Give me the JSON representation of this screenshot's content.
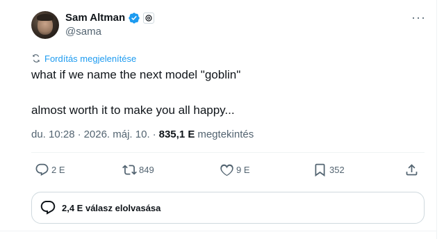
{
  "author": {
    "name": "Sam Altman",
    "handle": "@sama"
  },
  "translate_link": "Fordítás megjelenítése",
  "tweet": {
    "line1": "what if we name the next model \"goblin\"",
    "line2": "almost worth it to make you all happy..."
  },
  "meta": {
    "time": "du. 10:28",
    "separator1": "·",
    "date": "2026. máj. 10.",
    "separator2": "·",
    "views_count": "835,1 E",
    "views_label": "megtekintés"
  },
  "actions": {
    "replies": "2 E",
    "reposts": "849",
    "likes": "9 E",
    "bookmarks": "352"
  },
  "read_replies": "2,4 E válasz elolvasása",
  "colors": {
    "accent": "#1d9bf0",
    "text": "#0f1419",
    "muted": "#536471",
    "border": "#cfd9de"
  },
  "icons": {
    "verified": "verified-badge-icon",
    "affiliate": "openai-affiliate-icon",
    "more": "more-dots-icon",
    "translate": "translate-icon",
    "reply": "reply-icon",
    "repost": "repost-icon",
    "like": "heart-icon",
    "bookmark": "bookmark-icon",
    "share": "share-icon",
    "replies_bubble": "chat-bubble-icon"
  }
}
